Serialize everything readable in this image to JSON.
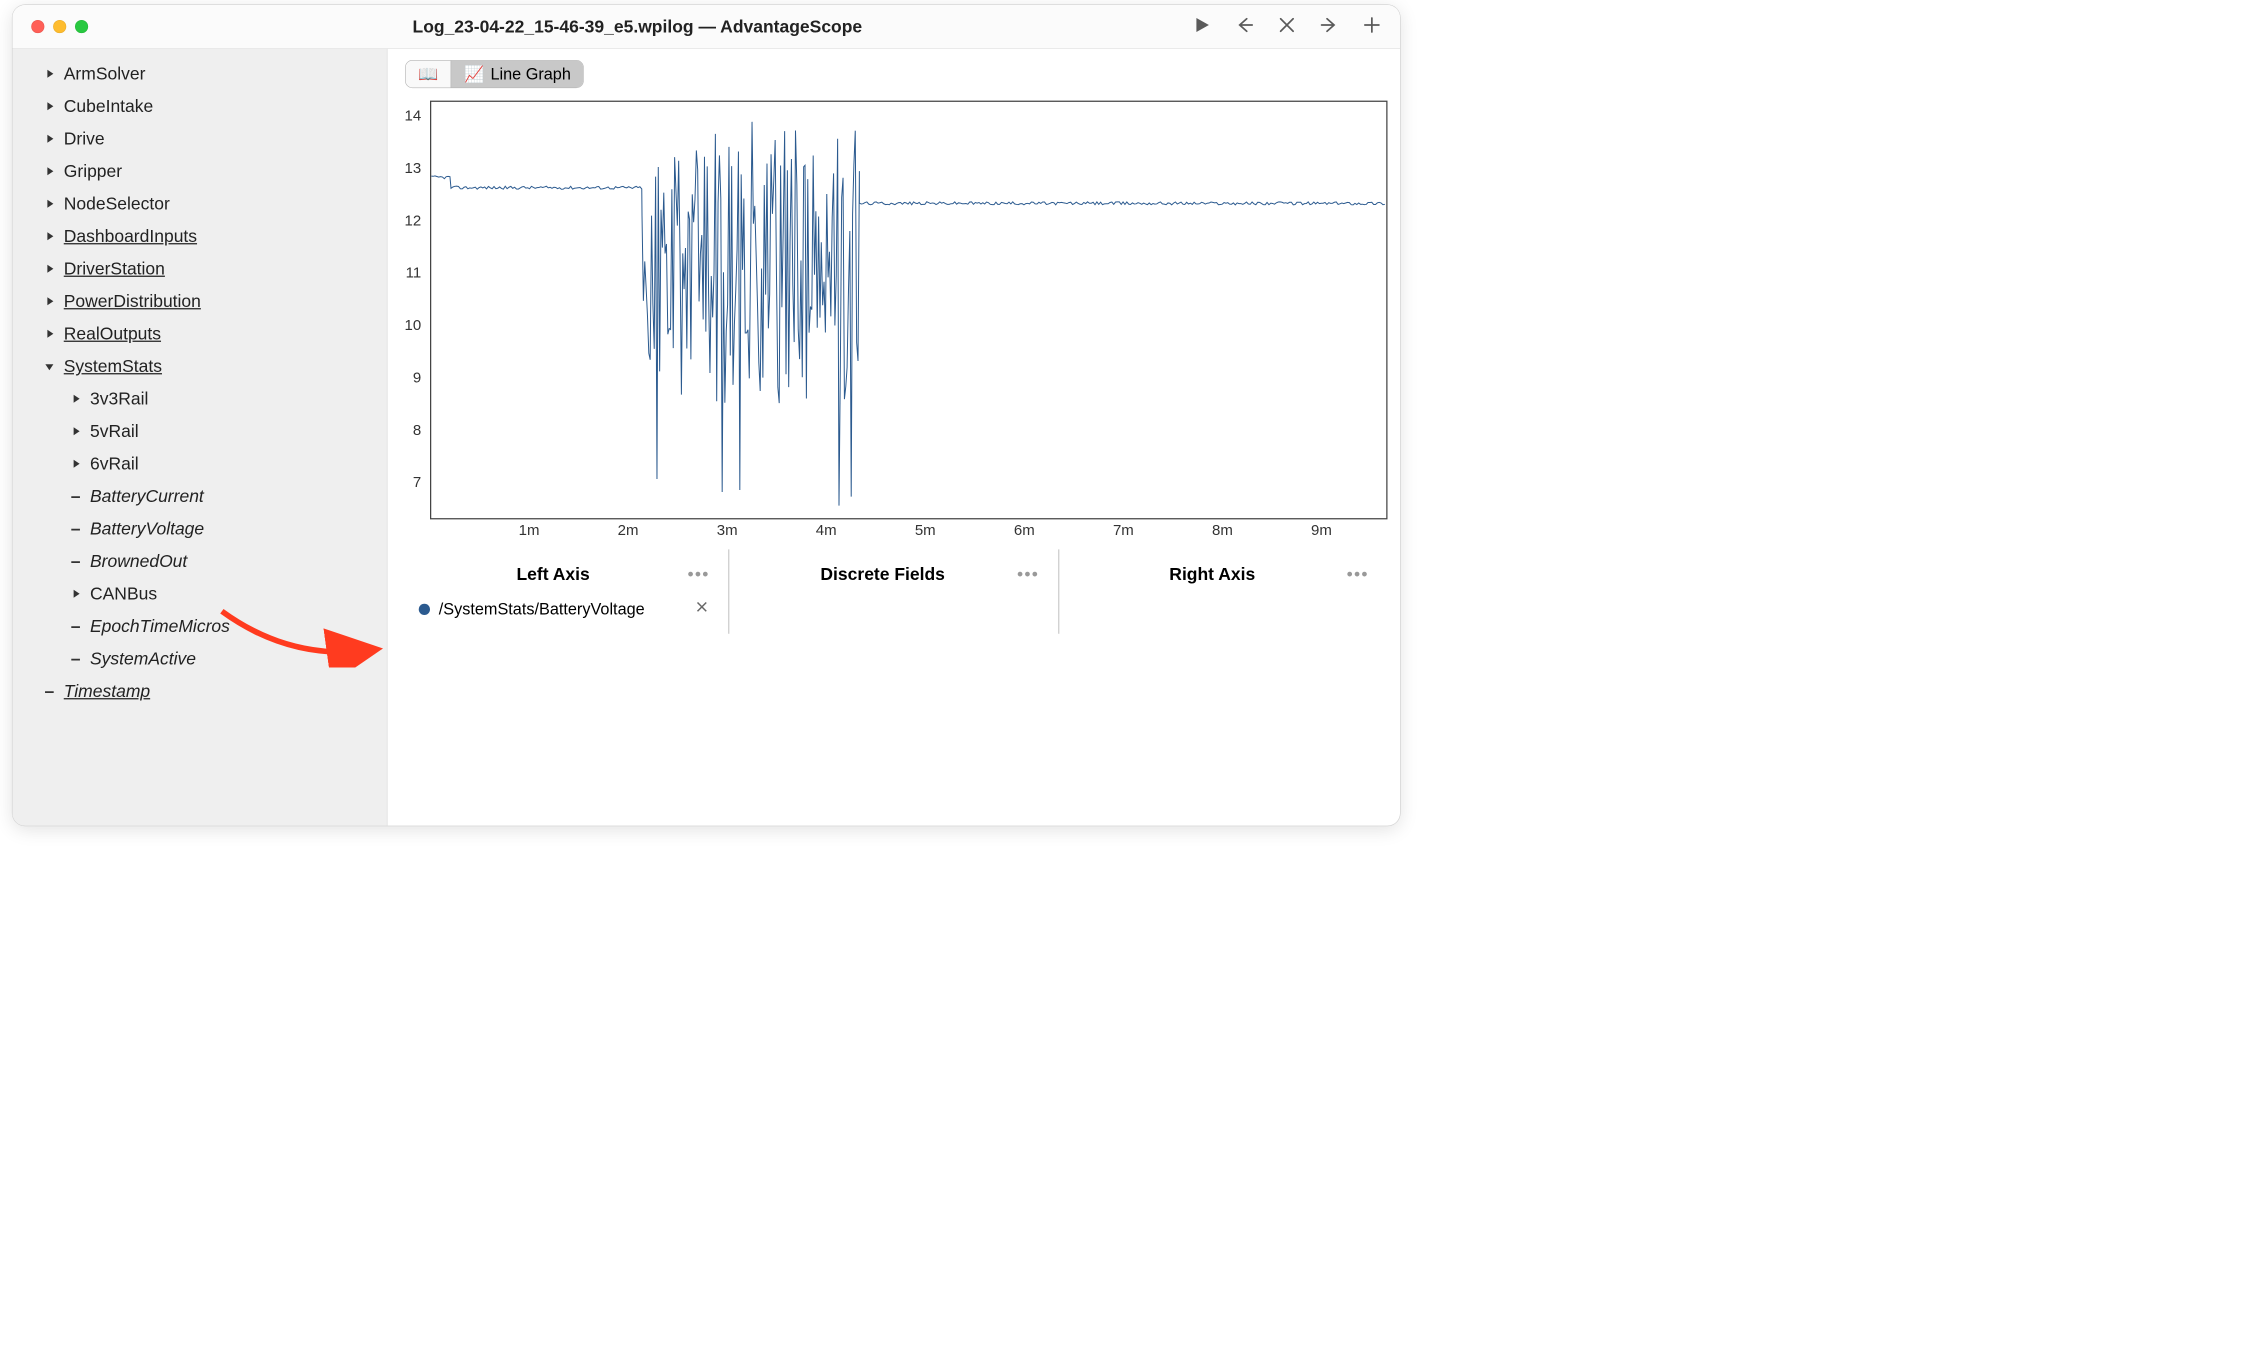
{
  "window": {
    "title": "Log_23-04-22_15-46-39_e5.wpilog — AdvantageScope"
  },
  "sidebar": {
    "items": [
      {
        "label": "ArmSolver",
        "expandable": true,
        "child": false
      },
      {
        "label": "CubeIntake",
        "expandable": true,
        "child": false
      },
      {
        "label": "Drive",
        "expandable": true,
        "child": false
      },
      {
        "label": "Gripper",
        "expandable": true,
        "child": false
      },
      {
        "label": "NodeSelector",
        "expandable": true,
        "child": false
      },
      {
        "label": "DashboardInputs",
        "expandable": true,
        "child": false,
        "underline": true
      },
      {
        "label": "DriverStation",
        "expandable": true,
        "child": false,
        "underline": true
      },
      {
        "label": "PowerDistribution",
        "expandable": true,
        "child": false,
        "underline": true
      },
      {
        "label": "RealOutputs",
        "expandable": true,
        "child": false,
        "underline": true
      },
      {
        "label": "SystemStats",
        "expandable": true,
        "child": false,
        "underline": true,
        "expanded": true
      },
      {
        "label": "3v3Rail",
        "expandable": true,
        "child": true
      },
      {
        "label": "5vRail",
        "expandable": true,
        "child": true
      },
      {
        "label": "6vRail",
        "expandable": true,
        "child": true
      },
      {
        "label": "BatteryCurrent",
        "expandable": false,
        "child": true,
        "italic": true
      },
      {
        "label": "BatteryVoltage",
        "expandable": false,
        "child": true,
        "italic": true
      },
      {
        "label": "BrownedOut",
        "expandable": false,
        "child": true,
        "italic": true
      },
      {
        "label": "CANBus",
        "expandable": true,
        "child": true
      },
      {
        "label": "EpochTimeMicros",
        "expandable": false,
        "child": true,
        "italic": true
      },
      {
        "label": "SystemActive",
        "expandable": false,
        "child": true,
        "italic": true
      },
      {
        "label": "Timestamp",
        "expandable": false,
        "child": false,
        "italic": true,
        "underline": true
      }
    ]
  },
  "tabs": {
    "items": [
      {
        "icon": "book",
        "label": ""
      },
      {
        "icon": "line-graph",
        "label": "Line Graph",
        "active": true
      }
    ]
  },
  "axis_panels": {
    "left": {
      "title": "Left Axis",
      "fields": [
        {
          "color": "#2b5a8f",
          "path": "/SystemStats/BatteryVoltage"
        }
      ]
    },
    "discrete": {
      "title": "Discrete Fields"
    },
    "right": {
      "title": "Right Axis"
    }
  },
  "chart_data": {
    "type": "line",
    "title": "",
    "xlabel": "",
    "ylabel": "",
    "x_ticks": [
      "1m",
      "2m",
      "3m",
      "4m",
      "5m",
      "6m",
      "7m",
      "8m",
      "9m"
    ],
    "y_ticks": [
      7,
      8,
      9,
      10,
      11,
      12,
      13,
      14
    ],
    "ylim": [
      6.3,
      14.3
    ],
    "x_unit": "minutes",
    "x_range_sec": [
      0,
      580
    ],
    "series": [
      {
        "name": "/SystemStats/BatteryVoltage",
        "color": "#2b5a8f",
        "segments": [
          {
            "type": "flat",
            "t0": 0,
            "t1": 12,
            "value": 12.85
          },
          {
            "type": "flat",
            "t0": 12,
            "t1": 128,
            "value": 12.65
          },
          {
            "type": "noise",
            "t0": 128,
            "t1": 260,
            "mean": 11.0,
            "min": 6.5,
            "max": 14.0,
            "freq": 160
          },
          {
            "type": "flat",
            "t0": 260,
            "t1": 580,
            "value": 12.35
          }
        ]
      }
    ]
  }
}
